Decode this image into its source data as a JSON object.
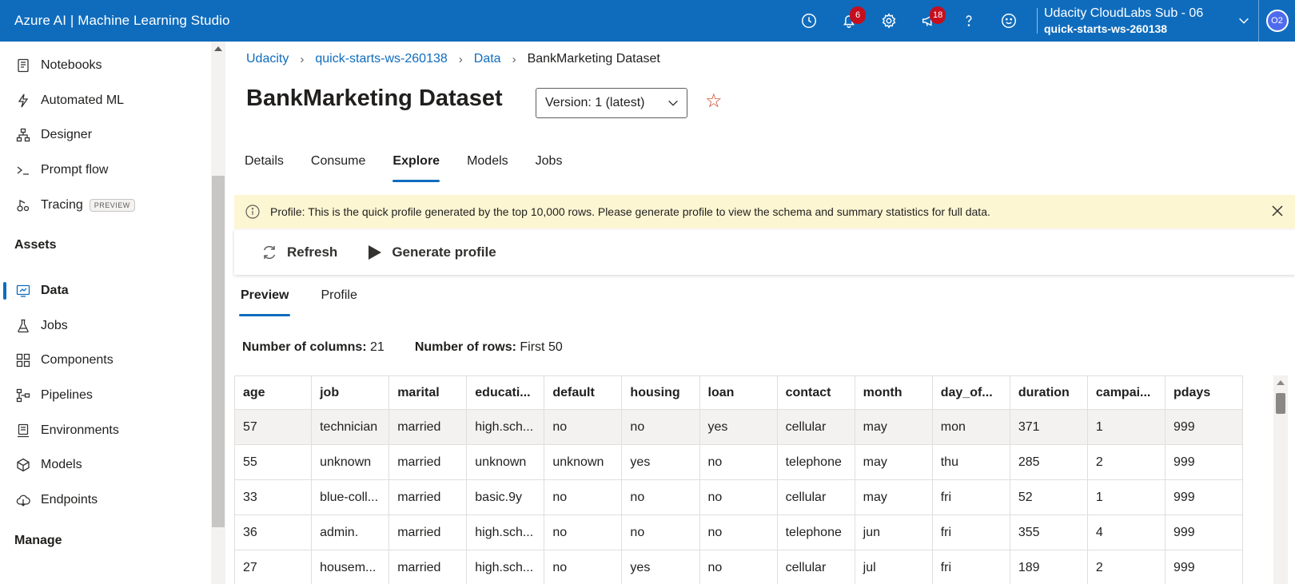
{
  "topbar": {
    "title": "Azure AI | Machine Learning Studio",
    "notifications_count": "6",
    "announcements_count": "18",
    "account_subscription": "Udacity CloudLabs Sub - 06",
    "account_workspace": "quick-starts-ws-260138",
    "avatar_initials": "O2"
  },
  "sidebar": {
    "items_top": [
      {
        "label": "Notebooks",
        "icon": "notebook-icon"
      },
      {
        "label": "Automated ML",
        "icon": "automl-icon"
      },
      {
        "label": "Designer",
        "icon": "designer-icon"
      },
      {
        "label": "Prompt flow",
        "icon": "prompt-icon"
      },
      {
        "label": "Tracing",
        "icon": "tracing-icon",
        "tag": "PREVIEW"
      }
    ],
    "assets_header": "Assets",
    "items_assets": [
      {
        "label": "Data",
        "icon": "data-icon",
        "active": true
      },
      {
        "label": "Jobs",
        "icon": "jobs-icon"
      },
      {
        "label": "Components",
        "icon": "components-icon"
      },
      {
        "label": "Pipelines",
        "icon": "pipelines-icon"
      },
      {
        "label": "Environments",
        "icon": "environments-icon"
      },
      {
        "label": "Models",
        "icon": "models-icon"
      },
      {
        "label": "Endpoints",
        "icon": "endpoints-icon"
      }
    ],
    "manage_header": "Manage"
  },
  "breadcrumb": {
    "items": [
      "Udacity",
      "quick-starts-ws-260138",
      "Data"
    ],
    "current": "BankMarketing Dataset"
  },
  "page": {
    "title": "BankMarketing Dataset",
    "version": "Version: 1 (latest)",
    "tabs": [
      "Details",
      "Consume",
      "Explore",
      "Models",
      "Jobs"
    ],
    "active_tab": "Explore"
  },
  "info_bar": {
    "text": "Profile: This is the quick profile generated by the top 10,000 rows. Please generate profile to view the schema and summary statistics for full data."
  },
  "toolbar": {
    "refresh_label": "Refresh",
    "generate_label": "Generate profile"
  },
  "subtabs": {
    "items": [
      "Preview",
      "Profile"
    ],
    "active": "Preview"
  },
  "counts": {
    "columns_label": "Number of columns:",
    "columns_value": "21",
    "rows_label": "Number of rows:",
    "rows_value": "First 50"
  },
  "grid": {
    "columns": [
      "age",
      "job",
      "marital",
      "educati...",
      "default",
      "housing",
      "loan",
      "contact",
      "month",
      "day_of...",
      "duration",
      "campai...",
      "pdays"
    ],
    "rows": [
      [
        "57",
        "technician",
        "married",
        "high.sch...",
        "no",
        "no",
        "yes",
        "cellular",
        "may",
        "mon",
        "371",
        "1",
        "999"
      ],
      [
        "55",
        "unknown",
        "married",
        "unknown",
        "unknown",
        "yes",
        "no",
        "telephone",
        "may",
        "thu",
        "285",
        "2",
        "999"
      ],
      [
        "33",
        "blue-coll...",
        "married",
        "basic.9y",
        "no",
        "no",
        "no",
        "cellular",
        "may",
        "fri",
        "52",
        "1",
        "999"
      ],
      [
        "36",
        "admin.",
        "married",
        "high.sch...",
        "no",
        "no",
        "no",
        "telephone",
        "jun",
        "fri",
        "355",
        "4",
        "999"
      ],
      [
        "27",
        "housem...",
        "married",
        "high.sch...",
        "no",
        "yes",
        "no",
        "cellular",
        "jul",
        "fri",
        "189",
        "2",
        "999"
      ]
    ]
  }
}
